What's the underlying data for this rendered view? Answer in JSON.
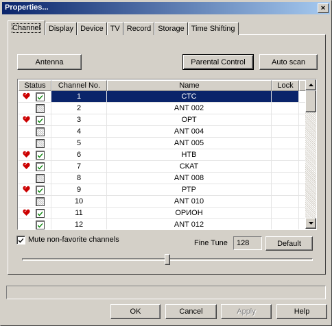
{
  "window": {
    "title": "Properties...",
    "close_glyph": "×"
  },
  "tabs": [
    {
      "label": "Channel",
      "active": true
    },
    {
      "label": "Display"
    },
    {
      "label": "Device"
    },
    {
      "label": "TV"
    },
    {
      "label": "Record"
    },
    {
      "label": "Storage"
    },
    {
      "label": "Time Shifting"
    }
  ],
  "buttons": {
    "antenna": "Antenna",
    "parental_control": "Parental Control",
    "auto_scan": "Auto scan",
    "default": "Default",
    "ok": "OK",
    "cancel": "Cancel",
    "apply": "Apply",
    "help": "Help"
  },
  "grid": {
    "columns": [
      "Status",
      "Channel No.",
      "Name",
      "Lock"
    ],
    "rows": [
      {
        "no": "1",
        "name": "СТС",
        "favorite": true,
        "checked": true,
        "selected": true
      },
      {
        "no": "2",
        "name": "ANT 002",
        "favorite": false,
        "checked": false
      },
      {
        "no": "3",
        "name": "ОРТ",
        "favorite": true,
        "checked": true
      },
      {
        "no": "4",
        "name": "ANT 004",
        "favorite": false,
        "checked": false
      },
      {
        "no": "5",
        "name": "ANT 005",
        "favorite": false,
        "checked": false
      },
      {
        "no": "6",
        "name": "НТВ",
        "favorite": true,
        "checked": true
      },
      {
        "no": "7",
        "name": "СКАТ",
        "favorite": true,
        "checked": true
      },
      {
        "no": "8",
        "name": "ANT 008",
        "favorite": false,
        "checked": false
      },
      {
        "no": "9",
        "name": "РТР",
        "favorite": true,
        "checked": true
      },
      {
        "no": "10",
        "name": "ANT 010",
        "favorite": false,
        "checked": false
      },
      {
        "no": "11",
        "name": "ОРИОН",
        "favorite": true,
        "checked": true
      },
      {
        "no": "12",
        "name": "ANT 012",
        "favorite": false,
        "checked": true
      }
    ]
  },
  "mute_non_favorite": {
    "label": "Mute non-favorite channels",
    "checked": true
  },
  "fine_tune": {
    "label": "Fine Tune",
    "value": "128"
  },
  "slider": {
    "position_fraction": 0.5
  },
  "colors": {
    "heart": "#cc0000",
    "selection": "#0a246a",
    "check": "#008000"
  }
}
